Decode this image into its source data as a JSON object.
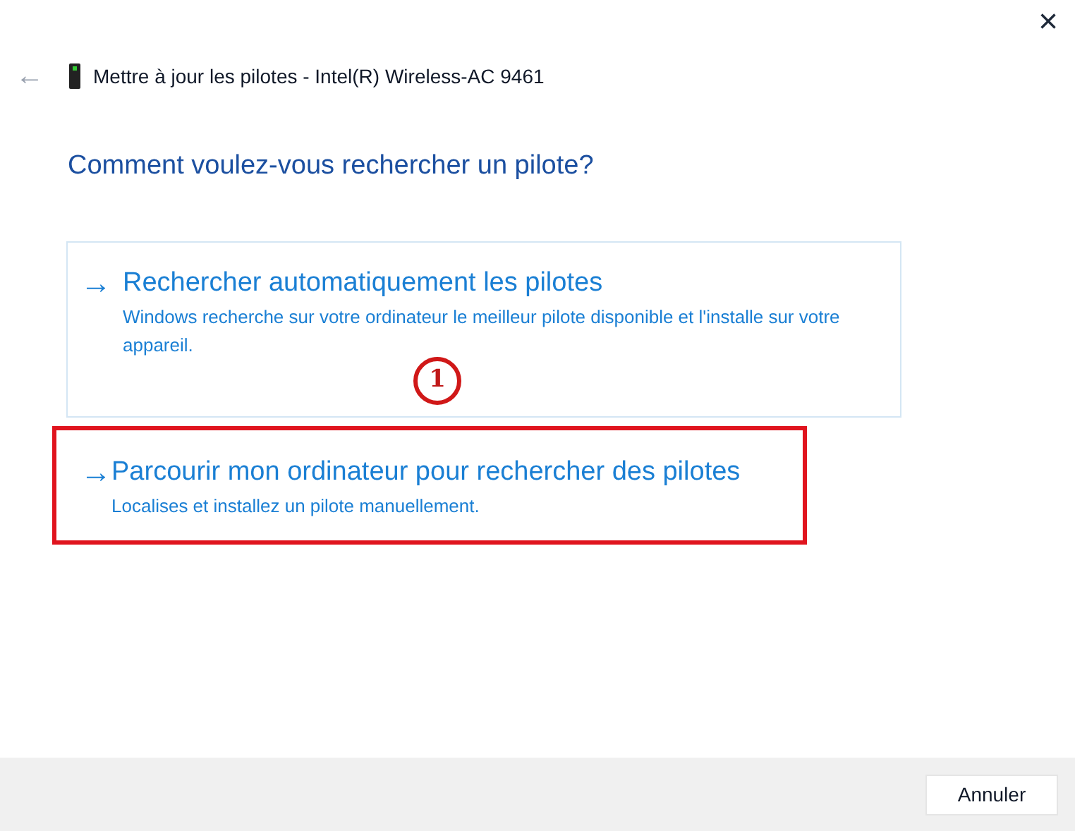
{
  "window": {
    "close": "×",
    "back": "←"
  },
  "header": {
    "title": "Mettre à jour les pilotes - Intel(R) Wireless-AC 9461"
  },
  "heading": "Comment voulez-vous rechercher un pilote?",
  "options": [
    {
      "arrow": "→",
      "title": "Rechercher automatiquement les pilotes",
      "description": "Windows recherche sur votre ordinateur le meilleur pilote disponible et l'installe sur votre appareil.",
      "hovered": true,
      "highlighted": false
    },
    {
      "arrow": "→",
      "title": "Parcourir mon ordinateur pour rechercher des pilotes",
      "description": "Localises et installez un pilote manuellement.",
      "hovered": false,
      "highlighted": true
    }
  ],
  "callout": "1",
  "buttons": [
    "Annuler"
  ]
}
